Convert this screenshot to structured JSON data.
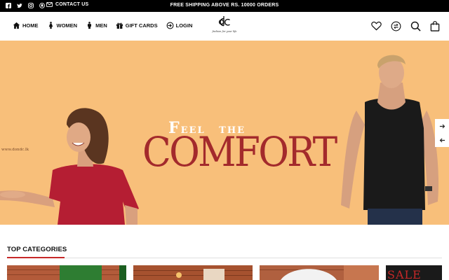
{
  "topbar": {
    "social_icons": [
      "facebook-icon",
      "twitter-icon",
      "instagram-icon",
      "snapchat-icon"
    ],
    "contact_label": "CONTACT US",
    "shipping_text": "FREE SHIPPING ABOVE RS. 10000 ORDERS"
  },
  "nav": {
    "links": [
      {
        "label": "HOME",
        "icon": "home-icon"
      },
      {
        "label": "WOMEN",
        "icon": "woman-icon"
      },
      {
        "label": "MEN",
        "icon": "man-icon"
      },
      {
        "label": "GIFT CARDS",
        "icon": "gift-icon"
      },
      {
        "label": "LOGIN",
        "icon": "login-icon"
      }
    ],
    "logo_text": "dC",
    "logo_tagline": "fashion for your life",
    "right_icons": [
      "heart-icon",
      "compare-icon",
      "search-icon",
      "bag-icon"
    ]
  },
  "hero": {
    "feel_text_f": "F",
    "feel_text_rest": "EEL   THE",
    "comfort_text": "COMFORT",
    "watermark": "www.dondc.lk",
    "colors": {
      "background": "#f8bf7a",
      "headline": "#a32a2c"
    }
  },
  "categories": {
    "title": "TOP CATEGORIES",
    "card_4_label": "SALE"
  }
}
